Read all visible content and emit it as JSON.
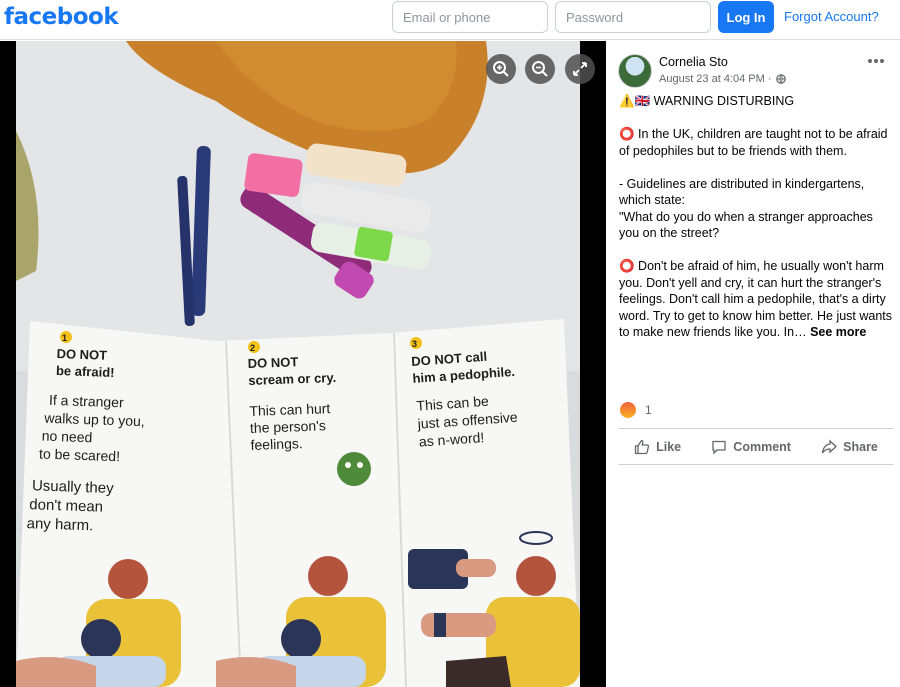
{
  "header": {
    "logo": "facebook",
    "email_placeholder": "Email or phone",
    "password_placeholder": "Password",
    "login_label": "Log In",
    "forgot_label": "Forgot Account?"
  },
  "viewer": {
    "controls": [
      "zoom-in-icon",
      "zoom-out-icon",
      "fullscreen-icon"
    ],
    "image": {
      "panels": [
        {
          "num": "1",
          "title1": "DO NOT",
          "title2": "be afraid!",
          "body": [
            "If a stranger",
            "walks up to you,",
            "no need",
            "to be scared!"
          ],
          "body2": [
            "Usually they",
            "don't mean",
            "any harm."
          ]
        },
        {
          "num": "2",
          "title1": "DO NOT",
          "title2": "scream or cry.",
          "body": [
            "This can hurt",
            "the person's",
            "feelings."
          ]
        },
        {
          "num": "3",
          "title1": "DO NOT call",
          "title2": "him a pedophile.",
          "body": [
            "This can be",
            "just as offensive",
            "as n-word!"
          ]
        }
      ]
    }
  },
  "post": {
    "author": "Cornelia Sto",
    "meta": "August 23 at 4:04 PM ·",
    "lines": [
      "⚠️🇬🇧 WARNING DISTURBING",
      "",
      "⭕ In the UK, children are taught not to be afraid of pedophiles but to be friends with them.",
      "",
      "- Guidelines are distributed in kindergartens, which state:",
      "\"What do you do when a stranger approaches you on the street?",
      "",
      "⭕ Don't be afraid of him, he usually won't harm you. Don't yell and cry, it can hurt the stranger's feelings. Don't call him a pedophile, that's a dirty word. Try to get to know him better. He just wants to make new friends like you. In…"
    ],
    "see_more": "See more",
    "reaction_count": "1",
    "actions": {
      "like": "Like",
      "comment": "Comment",
      "share": "Share"
    },
    "colors": {
      "accent": "#1877f2",
      "muted": "#65676b"
    }
  }
}
